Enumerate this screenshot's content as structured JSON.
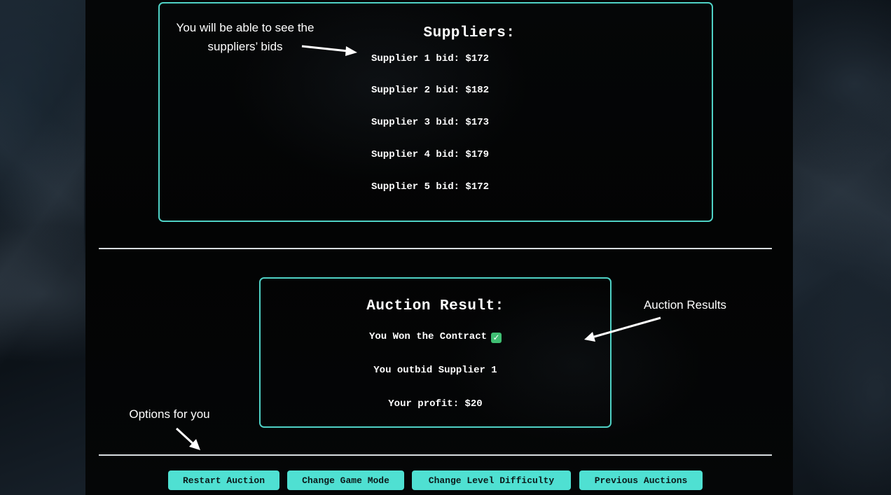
{
  "suppliers": {
    "title": "Suppliers:",
    "bids": [
      "Supplier 1 bid: $172",
      "Supplier 2 bid: $182",
      "Supplier 3 bid: $173",
      "Supplier 4 bid: $179",
      "Supplier 5 bid: $172"
    ]
  },
  "result": {
    "title": "Auction Result:",
    "won": "You Won the Contract",
    "won_icon": "check-mark-icon",
    "outbid": "You outbid Supplier 1",
    "profit": "Your profit: $20"
  },
  "buttons": {
    "restart": "Restart Auction",
    "change_mode": "Change Game Mode",
    "change_difficulty": "Change Level Difficulty",
    "previous": "Previous Auctions"
  },
  "annotations": {
    "bids_line1": "You will be able to see the",
    "bids_line2": "suppliers’ bids",
    "results": "Auction Results",
    "options": "Options for you"
  },
  "colors": {
    "accent": "#4fd1c5",
    "button_bg": "#4fe0d2",
    "panel_bg": "#050607",
    "check": "#3fbf73"
  }
}
